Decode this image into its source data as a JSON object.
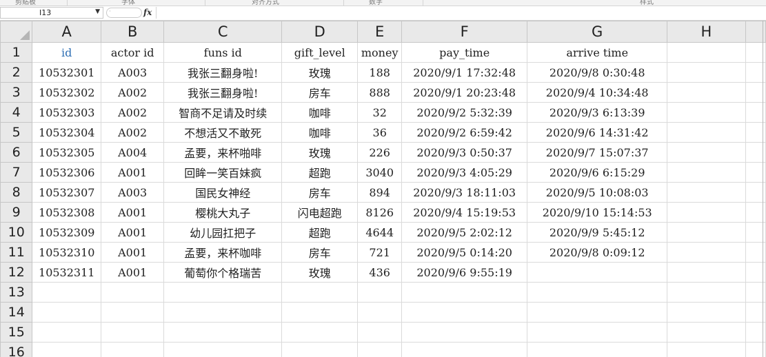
{
  "ribbon": {
    "groups": [
      "剪贴板",
      "字体",
      "对齐方式",
      "数字",
      "样式"
    ]
  },
  "formula_bar": {
    "name_box": "I13",
    "fx_label": "fx",
    "formula": ""
  },
  "sheet": {
    "column_headers": [
      "A",
      "B",
      "C",
      "D",
      "E",
      "F",
      "G",
      "H"
    ],
    "row_numbers": [
      "1",
      "2",
      "3",
      "4",
      "5",
      "6",
      "7",
      "8",
      "9",
      "10",
      "11",
      "12",
      "13",
      "14",
      "15",
      "16"
    ],
    "header_row": [
      "id",
      "actor id",
      "funs id",
      "gift_level",
      "money",
      "pay_time",
      "arrive time",
      ""
    ],
    "rows": [
      [
        "10532301",
        "A003",
        "我张三翻身啦!",
        "玫瑰",
        "188",
        "2020/9/1 17:32:48",
        "2020/9/8 0:30:48",
        ""
      ],
      [
        "10532302",
        "A002",
        "我张三翻身啦!",
        "房车",
        "888",
        "2020/9/1 20:23:48",
        "2020/9/4 10:34:48",
        ""
      ],
      [
        "10532303",
        "A002",
        "智商不足请及时续",
        "咖啡",
        "32",
        "2020/9/2 5:32:39",
        "2020/9/3 6:13:39",
        ""
      ],
      [
        "10532304",
        "A002",
        "不想活又不敢死",
        "咖啡",
        "36",
        "2020/9/2 6:59:42",
        "2020/9/6 14:31:42",
        ""
      ],
      [
        "10532305",
        "A004",
        "孟要，来杯啪啡",
        "玫瑰",
        "226",
        "2020/9/3 0:50:37",
        "2020/9/7 15:07:37",
        ""
      ],
      [
        "10532306",
        "A001",
        "回眸一笑百妹疯",
        "超跑",
        "3040",
        "2020/9/3 4:05:29",
        "2020/9/6 6:15:29",
        ""
      ],
      [
        "10532307",
        "A003",
        "国民女神经",
        "房车",
        "894",
        "2020/9/3 18:11:03",
        "2020/9/5 10:08:03",
        ""
      ],
      [
        "10532308",
        "A001",
        "樱桃大丸子",
        "闪电超跑",
        "8126",
        "2020/9/4 15:19:53",
        "2020/9/10 15:14:53",
        ""
      ],
      [
        "10532309",
        "A001",
        "幼儿园扛把子",
        "超跑",
        "4644",
        "2020/9/5 2:02:12",
        "2020/9/9 5:45:12",
        ""
      ],
      [
        "10532310",
        "A001",
        "孟要，来杯咖啡",
        "房车",
        "721",
        "2020/9/5 0:14:20",
        "2020/9/8 0:09:12",
        ""
      ],
      [
        "10532311",
        "A001",
        "葡萄你个格瑞苦",
        "玫瑰",
        "436",
        "2020/9/6 9:55:19",
        "",
        ""
      ],
      [
        "",
        "",
        "",
        "",
        "",
        "",
        "",
        ""
      ],
      [
        "",
        "",
        "",
        "",
        "",
        "",
        "",
        ""
      ],
      [
        "",
        "",
        "",
        "",
        "",
        "",
        "",
        ""
      ],
      [
        "",
        "",
        "",
        "",
        "",
        "",
        "",
        ""
      ]
    ],
    "accent_color": "#2e6fb4"
  }
}
